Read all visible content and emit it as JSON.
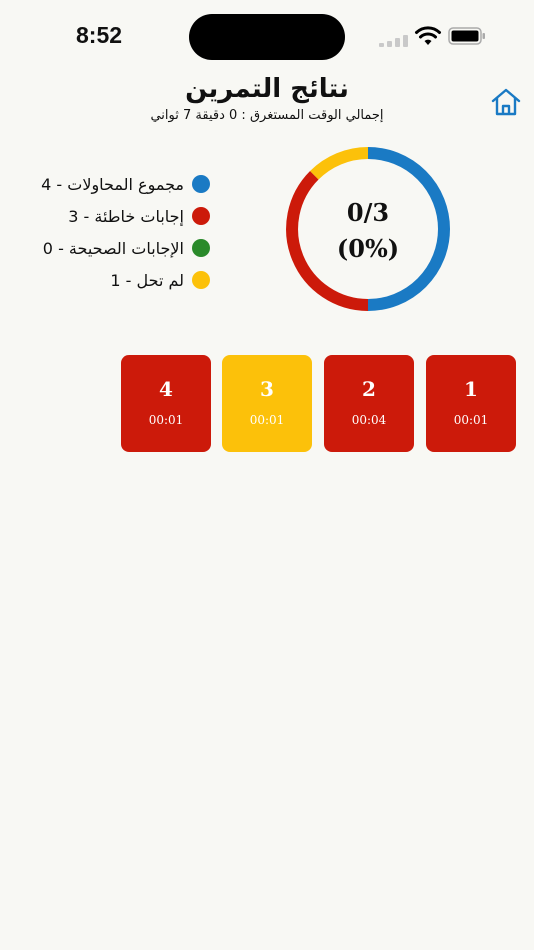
{
  "status_bar": {
    "time": "8:52"
  },
  "header": {
    "title": "نتائج التمرين",
    "subtitle": "إجمالي الوقت المستغرق : 0 دقيقة 7 ثواني"
  },
  "summary": {
    "score": "0/3",
    "percent": "(0%)"
  },
  "legend": [
    {
      "label": "مجموع المحاولات - 4",
      "color": "#1a7ac4"
    },
    {
      "label": "إجابات خاطئة - 3",
      "color": "#cc1a0a"
    },
    {
      "label": "الإجابات الصحيحة - 0",
      "color": "#2a8a2a"
    },
    {
      "label": "لم تحل - 1",
      "color": "#fcc10a"
    }
  ],
  "ring": {
    "attempts": 4,
    "segments": [
      {
        "name": "correct",
        "value": 0,
        "color": "#2a8a2a"
      },
      {
        "name": "wrong",
        "value": 2,
        "color": "#1a7ac4"
      },
      {
        "name": "wrong2",
        "value": 1.5,
        "color": "#cc1a0a"
      },
      {
        "name": "unanswered",
        "value": 0.5,
        "color": "#fcc10a"
      }
    ]
  },
  "questions": [
    {
      "number": "1",
      "time": "00:01",
      "color": "#cc1a0a"
    },
    {
      "number": "2",
      "time": "00:04",
      "color": "#cc1a0a"
    },
    {
      "number": "3",
      "time": "00:01",
      "color": "#fcc10a"
    },
    {
      "number": "4",
      "time": "00:01",
      "color": "#cc1a0a"
    }
  ]
}
